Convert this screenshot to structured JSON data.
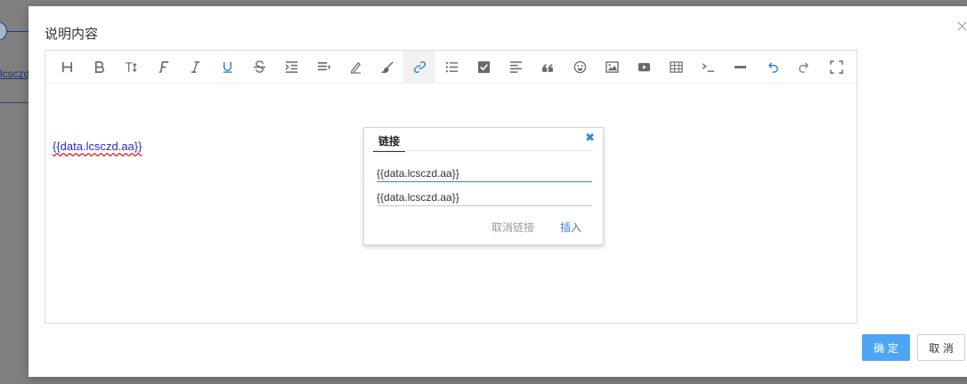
{
  "background": {
    "link_text": "lcsczd"
  },
  "modal": {
    "title": "说明内容",
    "ok_label": "确 定",
    "cancel_label": "取 消"
  },
  "editor": {
    "content_text": "{{data.lcsczd.aa}}",
    "toolbar": [
      {
        "name": "heading-icon",
        "glyph": "H"
      },
      {
        "name": "bold-icon",
        "glyph": "B"
      },
      {
        "name": "font-size-icon",
        "glyph": "T↕"
      },
      {
        "name": "font-family-icon",
        "glyph": "F"
      },
      {
        "name": "italic-icon",
        "glyph": "I"
      },
      {
        "name": "underline-icon",
        "glyph": "U"
      },
      {
        "name": "strikethrough-icon",
        "glyph": "S"
      },
      {
        "name": "indent-icon",
        "glyph": "⇥"
      },
      {
        "name": "line-height-icon",
        "glyph": "≡"
      },
      {
        "name": "font-color-icon",
        "glyph": "✎"
      },
      {
        "name": "background-color-icon",
        "glyph": "🖌"
      },
      {
        "name": "link-icon",
        "glyph": "🔗"
      },
      {
        "name": "list-icon",
        "glyph": "☰"
      },
      {
        "name": "todo-icon",
        "glyph": "☑"
      },
      {
        "name": "align-icon",
        "glyph": "≣"
      },
      {
        "name": "quote-icon",
        "glyph": "❝"
      },
      {
        "name": "emoticon-icon",
        "glyph": "☺"
      },
      {
        "name": "image-icon",
        "glyph": "▣"
      },
      {
        "name": "video-icon",
        "glyph": "▶"
      },
      {
        "name": "table-icon",
        "glyph": "▦"
      },
      {
        "name": "code-icon",
        "glyph": ">_"
      },
      {
        "name": "divider-icon",
        "glyph": "—"
      },
      {
        "name": "undo-icon",
        "glyph": "↶"
      },
      {
        "name": "redo-icon",
        "glyph": "↷"
      },
      {
        "name": "fullscreen-icon",
        "glyph": "⛶"
      }
    ]
  },
  "link_popover": {
    "tab_label": "链接",
    "close_glyph": "✖",
    "text_value": "{{data.lcsczd.aa}}",
    "url_value": "{{data.lcsczd.aa}}",
    "unlink_label": "取消链接",
    "insert_label": "插入"
  },
  "colors": {
    "accent": "#3a80d9",
    "primary_button": "#4fa5f5",
    "overlay": "#7f7f7f"
  }
}
